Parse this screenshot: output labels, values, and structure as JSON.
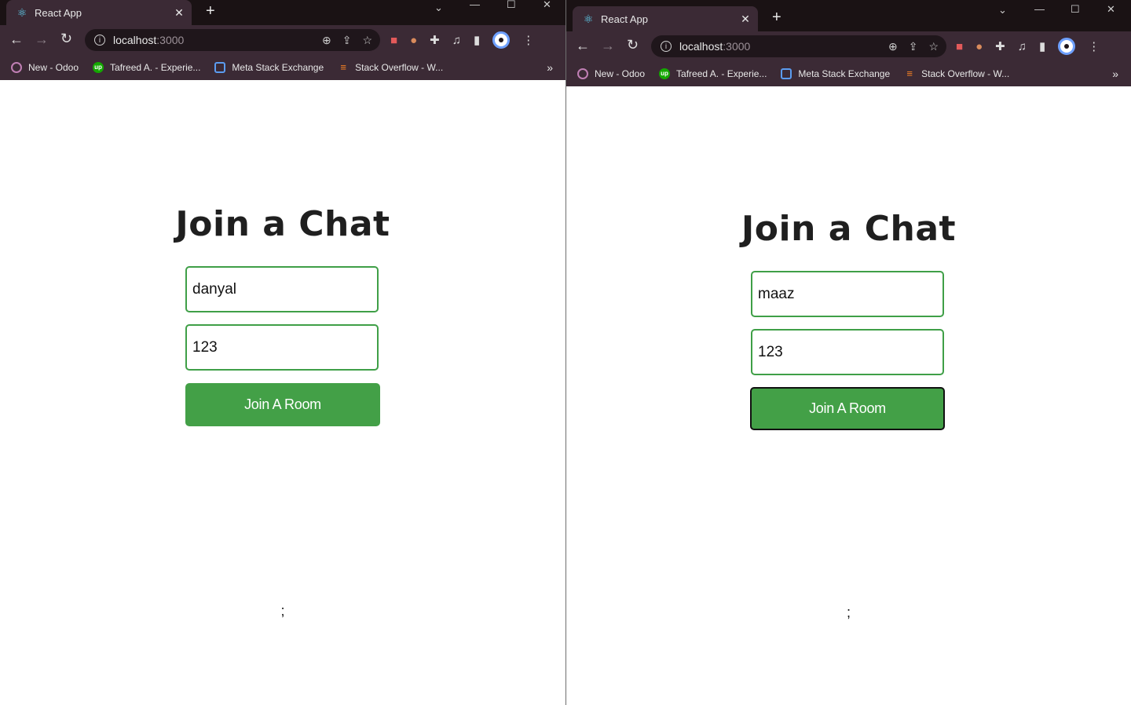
{
  "windows": [
    {
      "tab_title": "React App",
      "url_host": "localhost",
      "url_port": ":3000",
      "bookmarks": [
        "New - Odoo",
        "Tafreed A. - Experie...",
        "Meta Stack Exchange",
        "Stack Overflow - W..."
      ],
      "heading": "Join a Chat",
      "username_value": "danyal",
      "room_value": "123",
      "button_label": "Join A Room",
      "footer_text": ";"
    },
    {
      "tab_title": "React App",
      "url_host": "localhost",
      "url_port": ":3000",
      "bookmarks": [
        "New - Odoo",
        "Tafreed A. - Experie...",
        "Meta Stack Exchange",
        "Stack Overflow - W..."
      ],
      "heading": "Join a Chat",
      "username_value": "maaz",
      "room_value": "123",
      "button_label": "Join A Room",
      "footer_text": ";"
    }
  ],
  "icons": {
    "react": "⚛",
    "close": "✕",
    "plus": "+",
    "back": "←",
    "forward": "→",
    "reload": "↻",
    "info": "i",
    "zoom": "⊕",
    "share": "⇪",
    "star": "☆",
    "puzzle": "✚",
    "media": "♫",
    "sidepanel": "▮",
    "menu": "⋮",
    "chevron_more": "»",
    "minimize": "—",
    "maximize": "☐",
    "dropdown": "⌄"
  },
  "colors": {
    "accent_green": "#43a047",
    "field_border": "#3f9f47",
    "chrome_bg": "#3b2a35",
    "titlebar_bg": "#1a1214"
  }
}
